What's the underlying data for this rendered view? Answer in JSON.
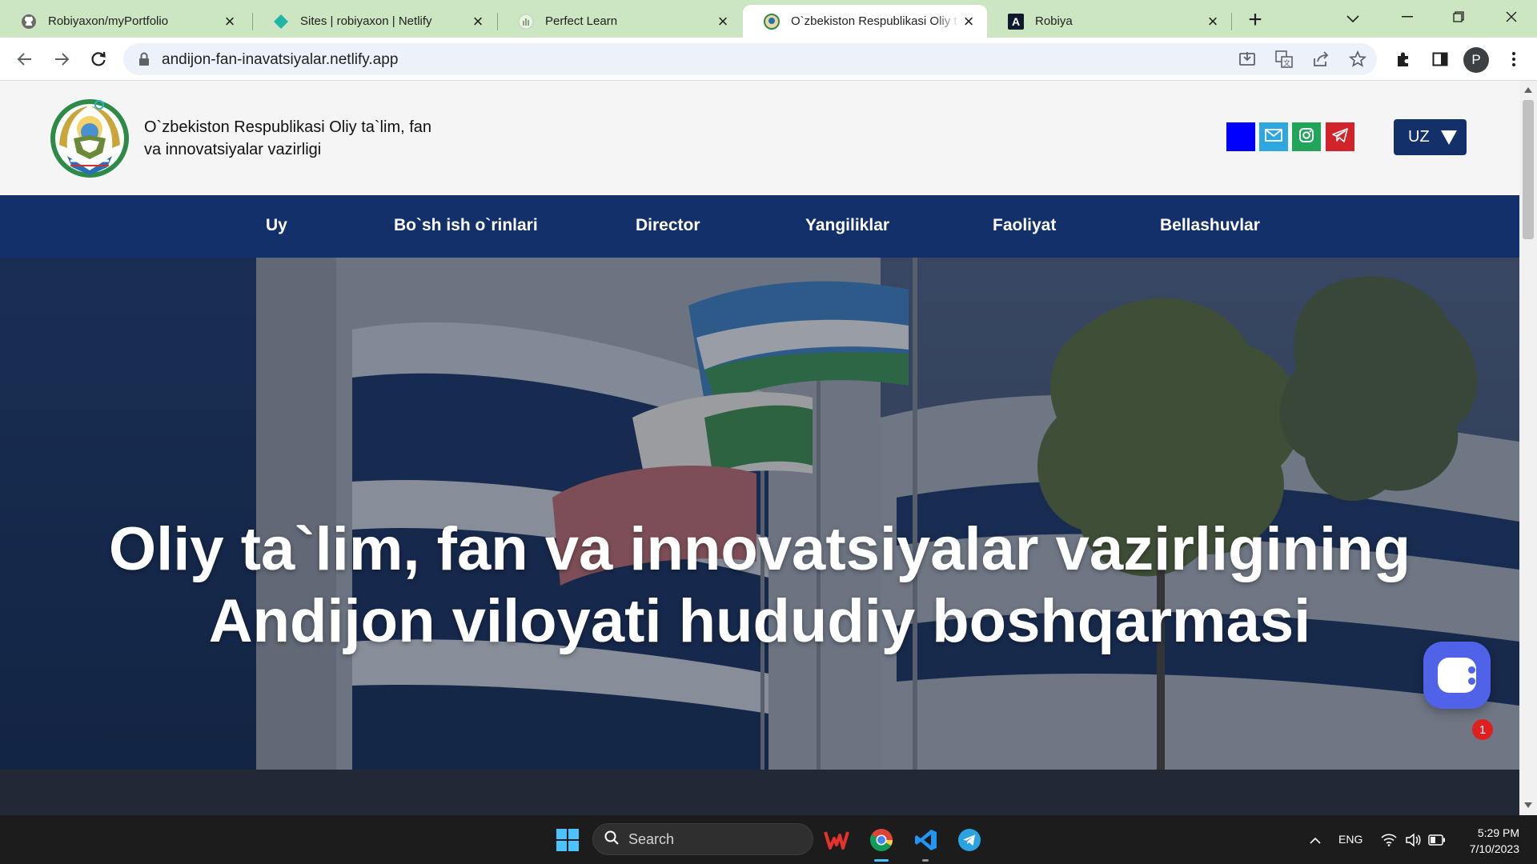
{
  "browser": {
    "tabs": [
      {
        "title": "Robiyaxon/myPortfolio",
        "icon": "github-icon",
        "active": false
      },
      {
        "title": "Sites | robiyaxon | Netlify",
        "icon": "netlify-icon",
        "active": false
      },
      {
        "title": "Perfect Learn",
        "icon": "chart-icon",
        "active": false
      },
      {
        "title": "O`zbekiston Respublikasi Oliy t",
        "icon": "emblem-icon",
        "active": true
      },
      {
        "title": "Robiya",
        "icon": "letter-a-icon",
        "active": false
      }
    ],
    "url": "andijon-fan-inavatsiyalar.netlify.app",
    "profile_initial": "P"
  },
  "site": {
    "name_line1": "O`zbekiston Respublikasi Oliy ta`lim, fan",
    "name_line2": "va innovatsiyalar vazirligi",
    "social": [
      {
        "icon": "facebook-icon",
        "color": "#0000ff"
      },
      {
        "icon": "mail-icon",
        "color": "#2ea7e0"
      },
      {
        "icon": "instagram-icon",
        "color": "#20a55a"
      },
      {
        "icon": "telegram-icon",
        "color": "#d0232a"
      }
    ],
    "language": "UZ",
    "nav": [
      "Uy",
      "Bo`sh ish o`rinlari",
      "Director",
      "Yangiliklar",
      "Faoliyat",
      "Bellashuvlar"
    ],
    "hero_title_line1": "Oliy ta`lim, fan va innovatsiyalar vazirligining",
    "hero_title_line2": "Andijon viloyati hududiy boshqarmasi",
    "chat_badge": "1",
    "colors": {
      "primary": "#13306a",
      "header_bg": "#f5f5f5"
    }
  },
  "taskbar": {
    "search_label": "Search",
    "lang": "ENG",
    "time": "5:29 PM",
    "date": "7/10/2023"
  }
}
